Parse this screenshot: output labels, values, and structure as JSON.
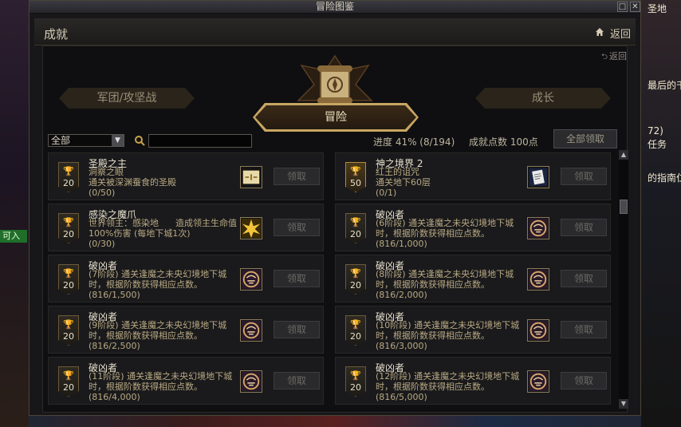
{
  "window": {
    "title": "冒险图鉴",
    "btn_min": "□",
    "btn_close": "✕"
  },
  "header": {
    "title": "成就",
    "back_label": "返回"
  },
  "inner_back": "返回",
  "tabs": {
    "left": "军团/攻坚战",
    "active": "冒险",
    "right": "成长"
  },
  "filter": {
    "dropdown_value": "全部",
    "search_value": ""
  },
  "stats": {
    "progress": "进度 41% (8/194)",
    "points": "成就点数 100点"
  },
  "claim_all_label": "全部领取",
  "background": {
    "top_right": "圣地",
    "right_line1": "最后的千",
    "right_line2": "72)",
    "right_line3": "任务",
    "right_line4": "的指南仁",
    "left_green": "可入"
  },
  "achievements": [
    {
      "title": "圣殿之主",
      "desc": "洞察之眼\n通关被深渊蚕食的圣殿",
      "progress": "(0/50)",
      "points": "20",
      "icon": "map-scroll-icon",
      "claim": "领取",
      "gold": false
    },
    {
      "title": "神之境界 2",
      "desc": "红王的诅咒\n通关地下60层",
      "progress": "(0/1)",
      "points": "50",
      "icon": "paper-note-icon",
      "claim": "领取",
      "gold": true
    },
    {
      "title": "感染之魔爪",
      "desc": "世界领主：感染地      造成领主生命值100%伤害 (每地下城1次)",
      "progress": "(0/30)",
      "points": "20",
      "icon": "burst-star-icon",
      "claim": "领取",
      "gold": false
    },
    {
      "title": "破凶者",
      "desc": "(6阶段) 通关逢魔之未央幻境地下城时，根据阶数获得相应点数。",
      "progress": "(816/1,000)",
      "points": "20",
      "icon": "demon-seal-icon",
      "claim": "领取",
      "gold": false
    },
    {
      "title": "破凶者",
      "desc": "(7阶段) 通关逢魔之未央幻境地下城时，根据阶数获得相应点数。",
      "progress": "(816/1,500)",
      "points": "20",
      "icon": "demon-seal-icon",
      "claim": "领取",
      "gold": false
    },
    {
      "title": "破凶者",
      "desc": "(8阶段) 通关逢魔之未央幻境地下城时，根据阶数获得相应点数。",
      "progress": "(816/2,000)",
      "points": "20",
      "icon": "demon-seal-icon",
      "claim": "领取",
      "gold": false
    },
    {
      "title": "破凶者",
      "desc": "(9阶段) 通关逢魔之未央幻境地下城时，根据阶数获得相应点数。",
      "progress": "(816/2,500)",
      "points": "20",
      "icon": "demon-seal-icon",
      "claim": "领取",
      "gold": false
    },
    {
      "title": "破凶者",
      "desc": "(10阶段) 通关逢魔之未央幻境地下城时，根据阶数获得相应点数。",
      "progress": "(816/3,000)",
      "points": "20",
      "icon": "demon-seal-icon",
      "claim": "领取",
      "gold": false
    },
    {
      "title": "破凶者",
      "desc": "(11阶段) 通关逢魔之未央幻境地下城时，根据阶数获得相应点数。",
      "progress": "(816/4,000)",
      "points": "20",
      "icon": "demon-seal-icon",
      "claim": "领取",
      "gold": false
    },
    {
      "title": "破凶者",
      "desc": "(12阶段) 通关逢魔之未央幻境地下城时，根据阶数获得相应点数。",
      "progress": "(816/5,000)",
      "points": "20",
      "icon": "demon-seal-icon",
      "claim": "领取",
      "gold": false
    }
  ]
}
